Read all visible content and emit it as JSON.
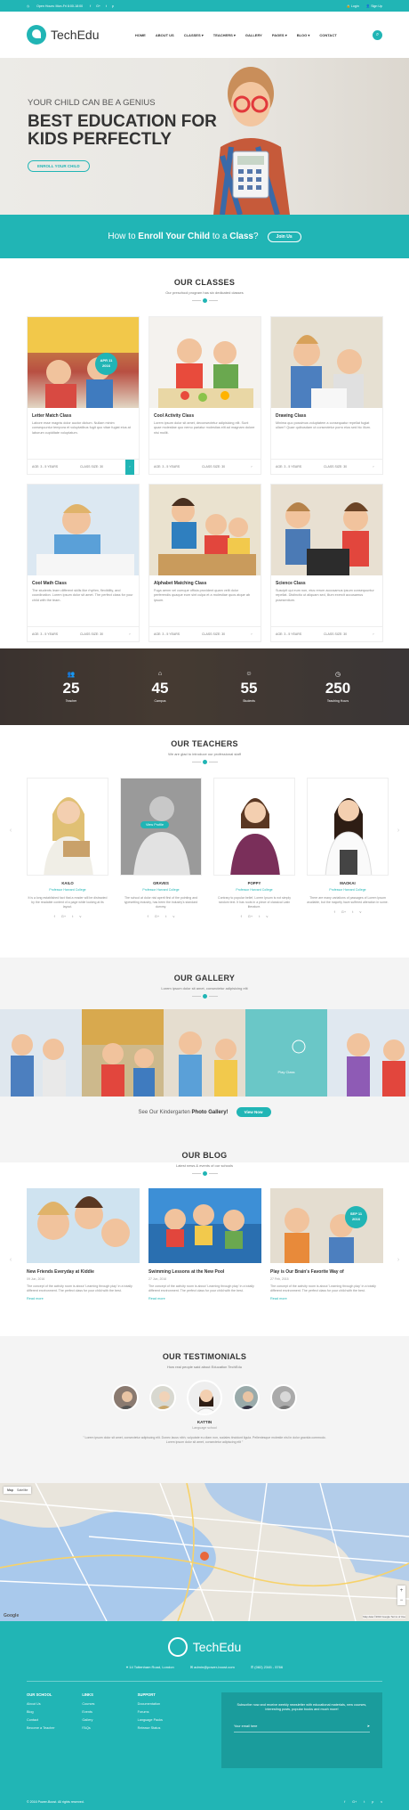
{
  "topbar": {
    "hours": "Open Hours: Mon-Fri 8:00-18:00",
    "social": [
      "f",
      "G+",
      "t",
      "p"
    ],
    "login": "Login",
    "signup": "Sign Up"
  },
  "header": {
    "logo": "TechEdu",
    "nav": [
      "HOME",
      "ABOUT US",
      "CLASSES",
      "TEACHERS",
      "GALLERY",
      "PAGES",
      "BLOG",
      "CONTACT"
    ]
  },
  "hero": {
    "subtitle": "YOUR CHILD CAN BE A GENIUS",
    "title": "BEST EDUCATION FOR KIDS PERFECTLY",
    "button": "ENROLL YOUR CHILD"
  },
  "enroll": {
    "pre": "How to",
    "strong": "Enroll Your Child",
    "mid": "to a",
    "strong2": "Class",
    "post": "?",
    "button": "Join Us"
  },
  "classes": {
    "title": "OUR CLASSES",
    "subtitle": "Our preschool program has six dedicated classes",
    "date_badge": [
      "APR 11",
      "2016"
    ],
    "items": [
      {
        "title": "Letter Match Class",
        "desc": "Labore esse magnis dolor auctor dictum. Nullam minim consequuntur tempora et voluptatibus fugit quo vitae fugiat eius at laborum cupiditate voluptatum.",
        "age": "AGE: 3 - 5 YEARS",
        "size": "CLASS SIZE: 30"
      },
      {
        "title": "Cool Activity Class",
        "desc": "Lorem ipsum dolor sit amet, deconsectetur adipisicing elit. Sunt quae molestiae quo nemo pariatur molestias elit ad magnam dolore nisi mollit.",
        "age": "AGE: 3 - 5 YEARS",
        "size": "CLASS SIZE: 30"
      },
      {
        "title": "Drawing Class",
        "desc": "Minima quo possimus voluptatem a consequatur repellat fugiat ullam? Quae quibusdam ut consectetur porro eius sed hic illum.",
        "age": "AGE: 3 - 5 YEARS",
        "size": "CLASS SIZE: 30"
      },
      {
        "title": "Cool Math Class",
        "desc": "The students learn different skills like rhythm, flexibility, and coordination. Lorem ipsum dolor sit amet. The perfect class for your child with the team.",
        "age": "AGE: 3 - 5 YEARS",
        "size": "CLASS SIZE: 30"
      },
      {
        "title": "Alphabet Matching Class",
        "desc": "Fuga aenm vel cumque officia provident quam velit dolor perferendis quaque eum sint culpa et a molestiae quos atque ab ipsum.",
        "age": "AGE: 3 - 5 YEARS",
        "size": "CLASS SIZE: 30"
      },
      {
        "title": "Science Class",
        "desc": "Suscipit qui eum non, eius rerum accusamus ipsum consequuntur repellat. Distinctio ut aliquam sed, illum exercit accusamus praesentium.",
        "age": "AGE: 3 - 5 YEARS",
        "size": "CLASS SIZE: 30"
      }
    ]
  },
  "stats": [
    {
      "icon": "teacher-icon",
      "value": "25",
      "label": "Teacher"
    },
    {
      "icon": "campus-icon",
      "value": "45",
      "label": "Campus"
    },
    {
      "icon": "students-icon",
      "value": "55",
      "label": "Students"
    },
    {
      "icon": "clock-icon",
      "value": "250",
      "label": "Teaching Hours"
    }
  ],
  "teachers": {
    "title": "OUR TEACHERS",
    "subtitle": "We are glad to introduce our professional staff",
    "view_profile": "View Profile",
    "items": [
      {
        "name": "KAILO",
        "role": "Professor Harvard College",
        "desc": "It is a long established fact that a reader will be distracted by the readable content of a page while looking at its layout."
      },
      {
        "name": "GRAVES",
        "role": "Professor Harvard College",
        "desc": "The school at dolor nisi aperit first of the pointing and typesetting industry, has been the industry's standard dummy."
      },
      {
        "name": "POPPY",
        "role": "Professor Harvard College",
        "desc": "Contrary to popular belief, Lorem Ipsum is not simply random text. It has roots in a piece of classical Latin literature."
      },
      {
        "name": "MAOKAI",
        "role": "Professor Harvard College",
        "desc": "There are many variations of passages of Lorem Ipsum available, but the majority have suffered alteration in some."
      }
    ]
  },
  "gallery": {
    "title": "OUR GALLERY",
    "subtitle": "Lorem ipsum dolor sit amet, consectetur adipisicing elit",
    "overlay": "Play Class",
    "footer_pre": "See Our Kindergarten",
    "footer_strong": "Photo Gallery!",
    "button": "View Now"
  },
  "blog": {
    "title": "OUR BLOG",
    "subtitle": "Latest news & events of our schools",
    "date_badge": [
      "SEP 11",
      "2016"
    ],
    "read_more": "Read more",
    "items": [
      {
        "title": "New Friends Everyday at Kiddie",
        "date": "09 Jun, 2016",
        "desc": "The concept of the activity room is about 'Learning through play' in a totally different environment. The perfect class for your child with the best."
      },
      {
        "title": "Swimming Lessons at the New Pool",
        "date": "27 Jun, 2016",
        "desc": "The concept of the activity room is about 'Learning through play' in a totally different environment. The perfect class for your child with the best."
      },
      {
        "title": "Play is Our Brain's Favorite Way of",
        "date": "27 Feb, 2015",
        "desc": "The concept of the activity room is about 'Learning through play' in a totally different environment. The perfect class for your child with the best."
      }
    ]
  },
  "testimonials": {
    "title": "OUR TESTIMONIALS",
    "subtitle": "How real people said about Education TechEdu",
    "name": "KATTIN",
    "role": "Language school",
    "quote": "\" Lorem ipsum dolor sit amet, consectetur adipiscing elit. Donec lacus nibh, vulputate eu diam non, sodales tincidunt ligula. Pellentesque molestie nisl in dolor gravida commodo. Lorem ipsum dolor sit amet, consectetur adipiscing elit \""
  },
  "map": {
    "tab_map": "Map",
    "tab_sat": "Satellite",
    "google": "Google",
    "terms": "Map data ©2016 Google  Terms of Use"
  },
  "footer": {
    "logo": "TechEdu",
    "address": "14 Tottenham Road, London",
    "email": "admin@power-boost.com",
    "phone": "(082) 2345 - 5766",
    "cols": [
      {
        "title": "OUR SCHOOL",
        "links": [
          "About Us",
          "Blog",
          "Contact",
          "Become a Teacher"
        ]
      },
      {
        "title": "LINKS",
        "links": [
          "Courses",
          "Events",
          "Gallery",
          "FAQs"
        ]
      },
      {
        "title": "SUPPORT",
        "links": [
          "Documentation",
          "Forums",
          "Language Packs",
          "Release Status"
        ]
      }
    ],
    "newsletter": "Subscribe now and receive weekly newsletter with educational materials, new courses, interesting posts, popular books and much more!",
    "email_placeholder": "Your email here",
    "copyright": "© 2016 Power-Boost. All rights reserved.",
    "social": [
      "f",
      "G+",
      "t",
      "p",
      "v"
    ]
  },
  "colors": {
    "accent": "#21b5b5"
  }
}
